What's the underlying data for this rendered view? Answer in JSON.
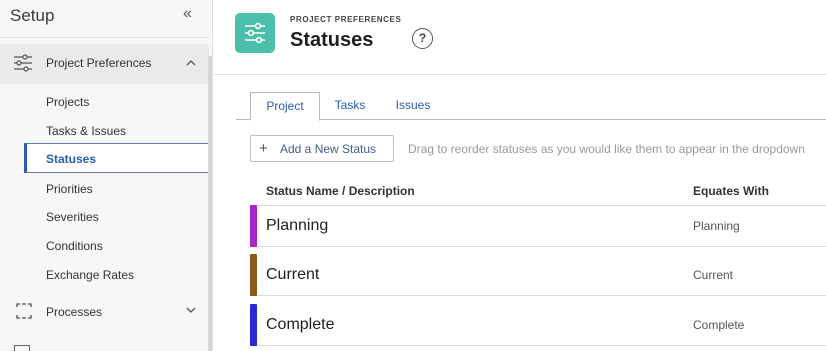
{
  "sidebar": {
    "title": "Setup",
    "collapse_icon": "double-chevron-left-icon",
    "group": {
      "label": "Project Preferences",
      "icon": "sliders-icon",
      "expanded": true
    },
    "items": [
      {
        "label": "Projects"
      },
      {
        "label": "Tasks & Issues"
      },
      {
        "label": "Statuses",
        "active": true
      },
      {
        "label": "Priorities"
      },
      {
        "label": "Severities"
      },
      {
        "label": "Conditions"
      },
      {
        "label": "Exchange Rates"
      }
    ],
    "group2": {
      "label": "Processes",
      "icon": "processes-icon",
      "expanded": false
    }
  },
  "header": {
    "eyebrow": "PROJECT PREFERENCES",
    "title": "Statuses",
    "icon": "sliders-icon",
    "help_label": "?"
  },
  "tabs": [
    {
      "label": "Project",
      "active": true
    },
    {
      "label": "Tasks"
    },
    {
      "label": "Issues"
    }
  ],
  "toolbar": {
    "add_label": "Add a New Status",
    "hint": "Drag to reorder statuses as you would like them to appear in the dropdown"
  },
  "table": {
    "headers": [
      "Status Name / Description",
      "Equates With"
    ],
    "rows": [
      {
        "name": "Planning",
        "equates": "Planning",
        "color": "#a626c4"
      },
      {
        "name": "Current",
        "equates": "Current",
        "color": "#8a5a19"
      },
      {
        "name": "Complete",
        "equates": "Complete",
        "color": "#2b2bd6"
      }
    ]
  },
  "colors": {
    "accent": "#2a5db0",
    "header_icon_bg": "#4cbfaa"
  }
}
